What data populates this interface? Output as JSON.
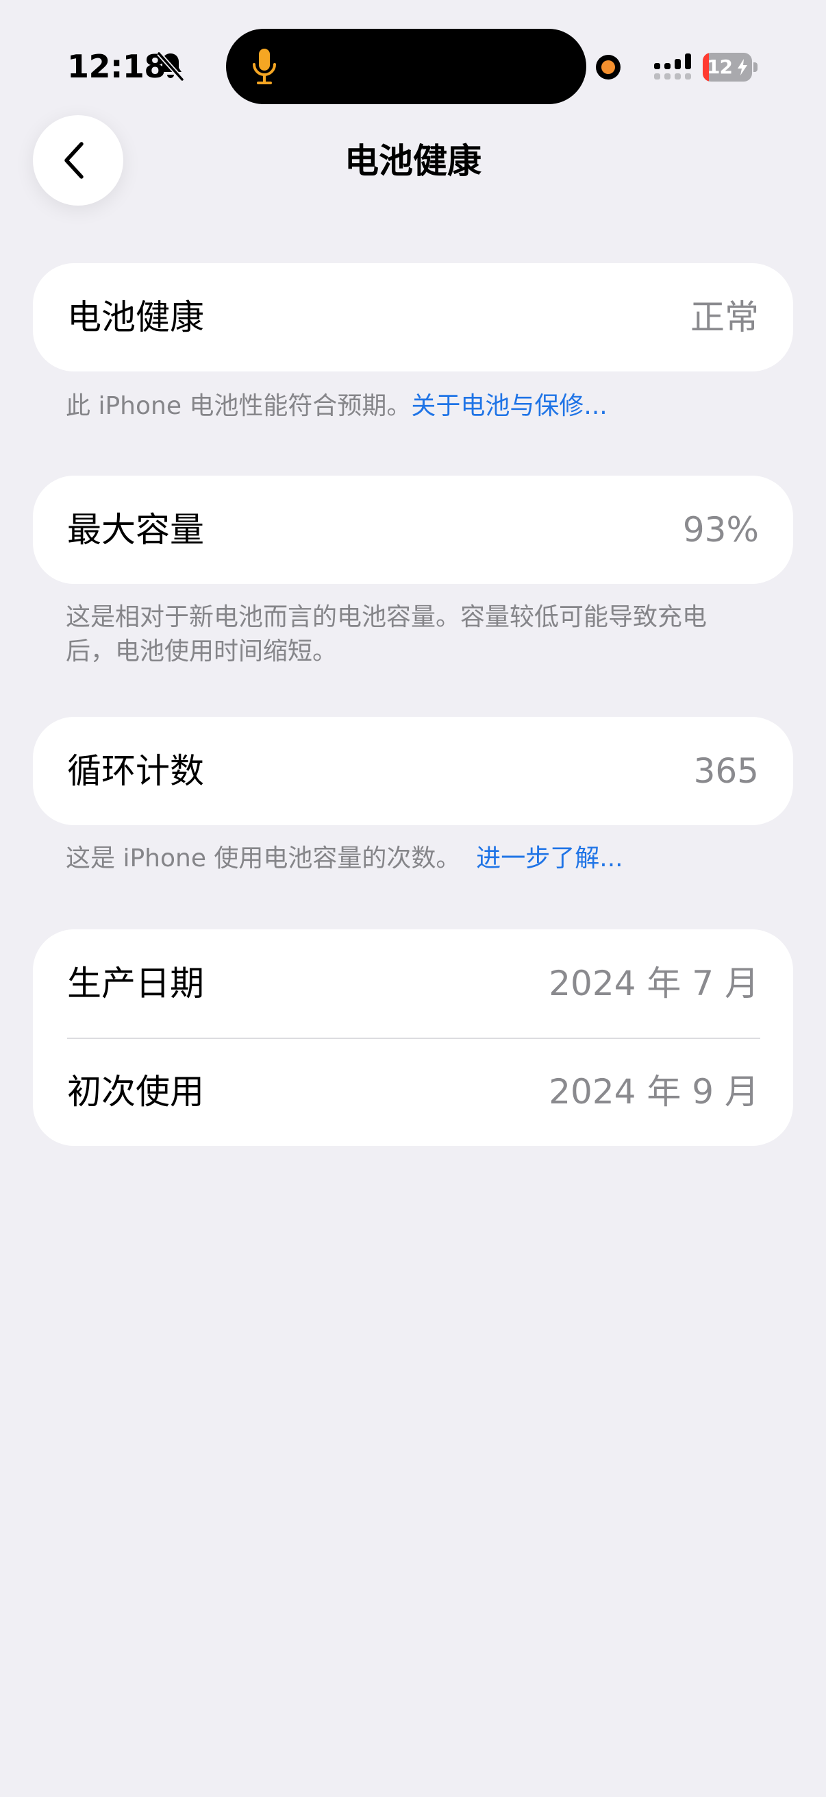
{
  "status_bar": {
    "time": "12:18",
    "battery_level": "12",
    "battery_fraction": 0.12,
    "icons": [
      "bell-slash-icon",
      "microphone-icon",
      "recording-indicator-icon",
      "cellular-signal-icon",
      "battery-charging-icon"
    ],
    "colors": {
      "mic": "#f5a623",
      "recording_dot": "#f5902e",
      "battery_low": "#ff3b30"
    }
  },
  "nav": {
    "back_icon": "chevron-left-icon",
    "title": "电池健康"
  },
  "sections": {
    "health": {
      "label": "电池健康",
      "value": "正常",
      "footer_text": "此 iPhone 电池性能符合预期。",
      "footer_link": "关于电池与保修..."
    },
    "capacity": {
      "label": "最大容量",
      "value": "93%",
      "footer_text": "这是相对于新电池而言的电池容量。容量较低可能导致充电后，电池使用时间缩短。"
    },
    "cycles": {
      "label": "循环计数",
      "value": "365",
      "footer_text": "这是 iPhone 使用电池容量的次数。",
      "footer_link": "进一步了解..."
    },
    "dates": {
      "manufacture_label": "生产日期",
      "manufacture_value": "2024 年 7 月",
      "first_use_label": "初次使用",
      "first_use_value": "2024 年 9 月"
    }
  },
  "theme": {
    "background": "#f0eff4",
    "card": "#ffffff",
    "secondary_text": "#8a8a8e",
    "link": "#1f74e6"
  }
}
